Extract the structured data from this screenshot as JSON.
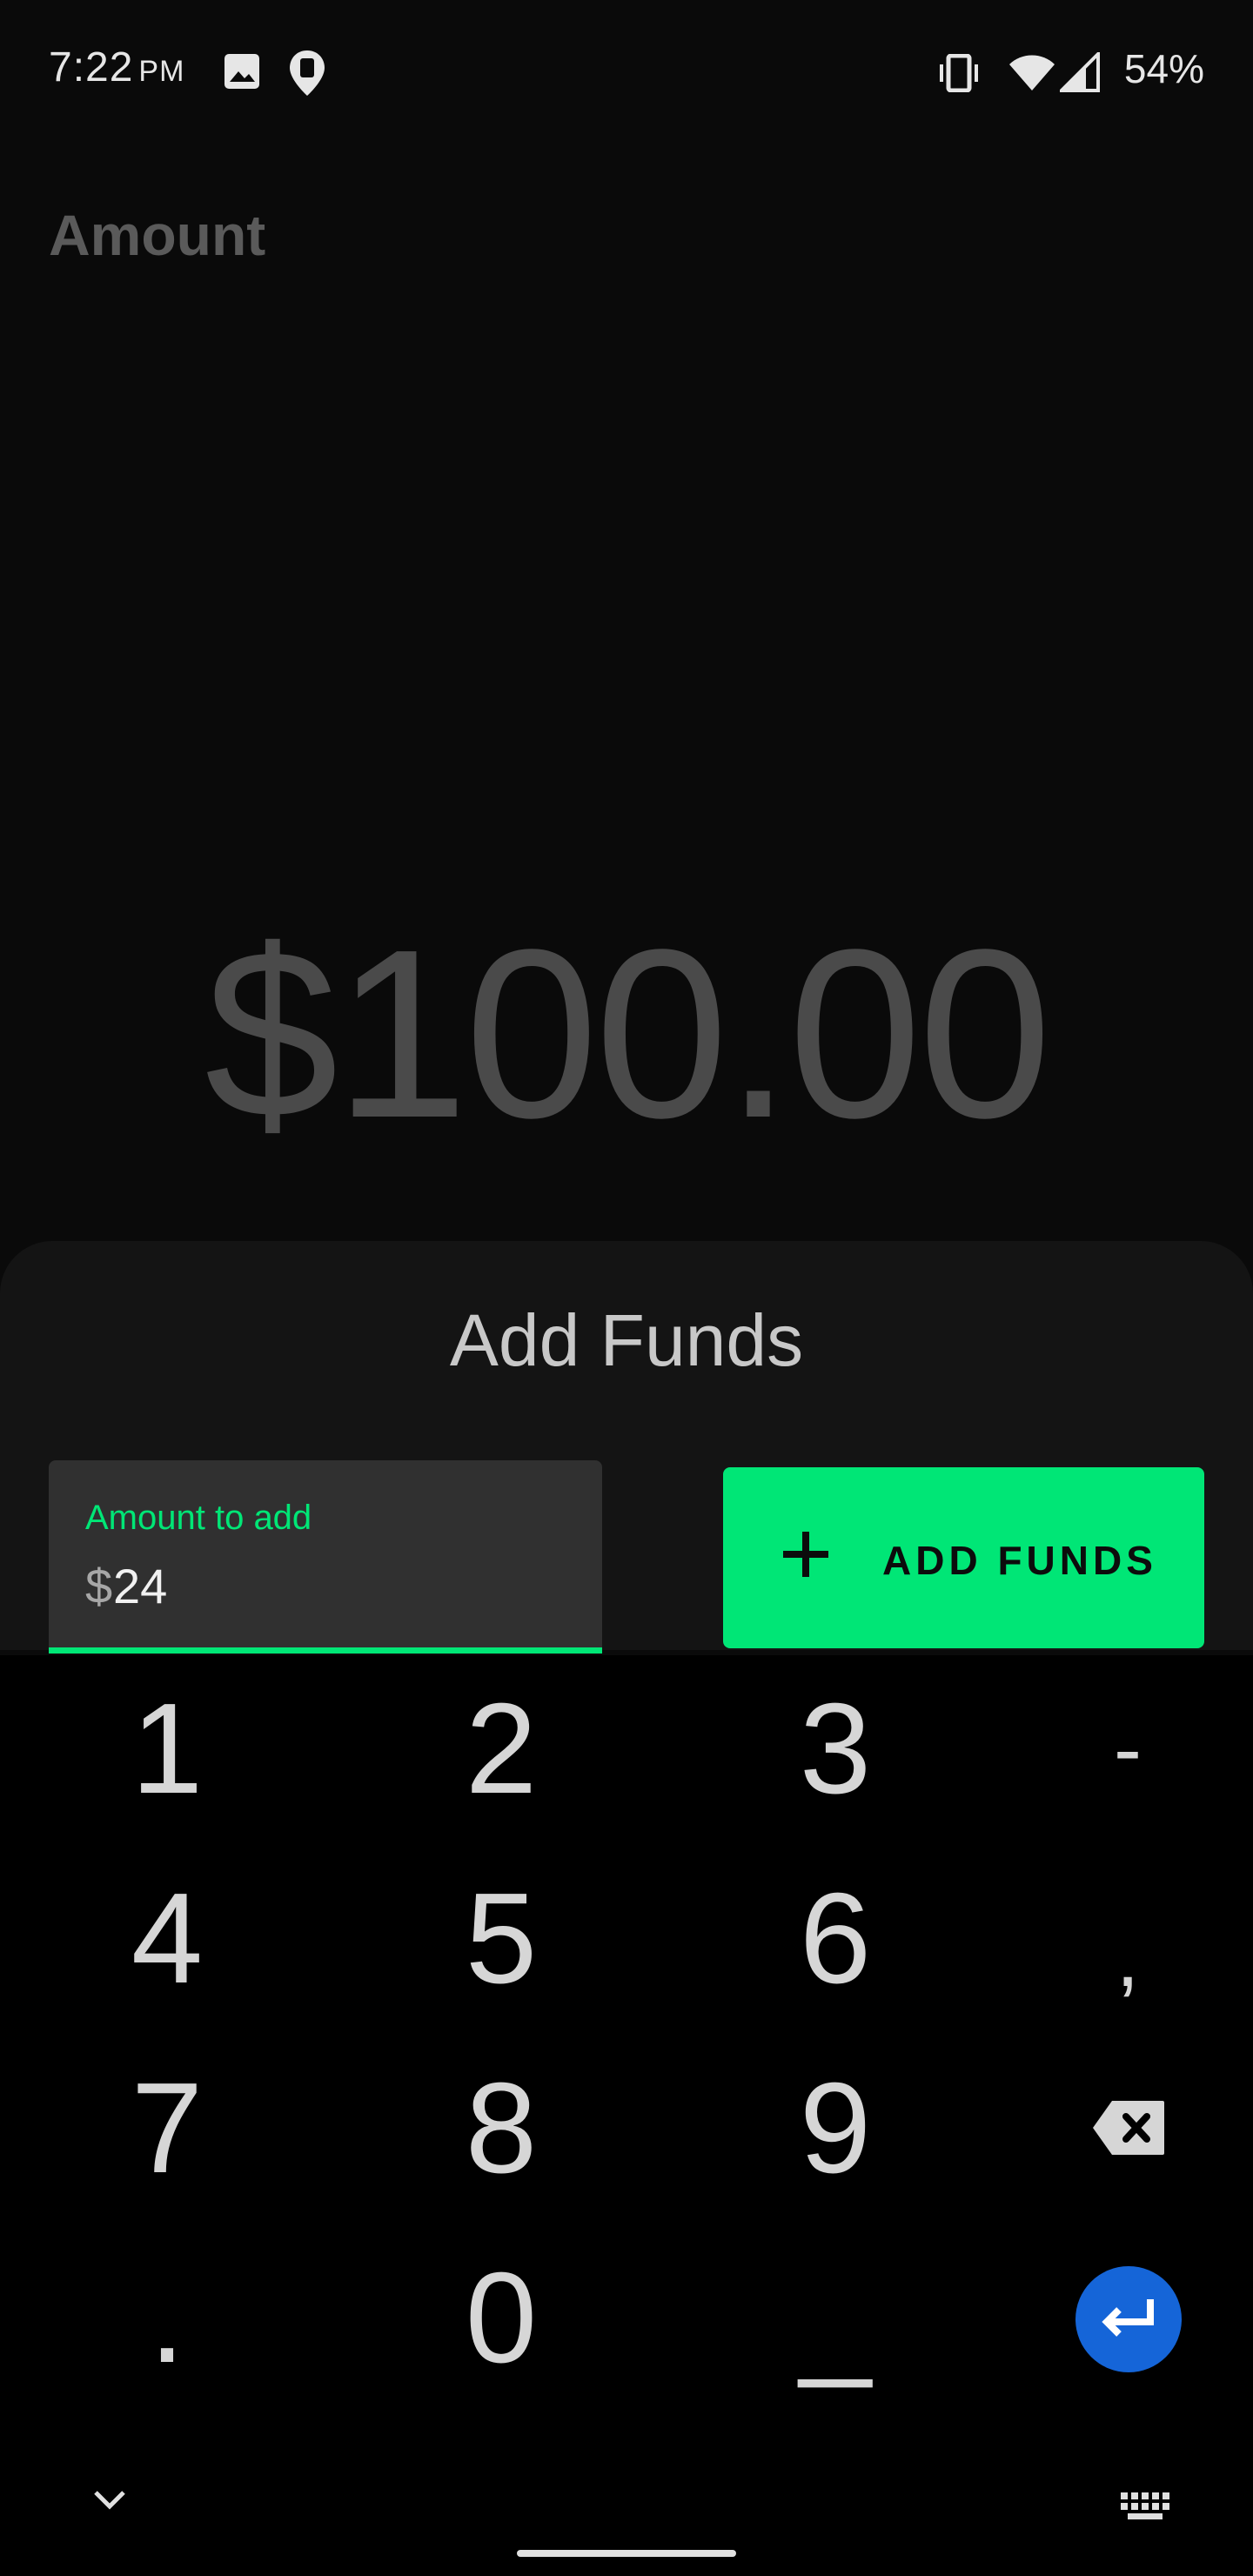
{
  "status_bar": {
    "time": "7:22",
    "ampm": "PM",
    "battery": "54%",
    "icons": [
      "image-icon",
      "location-pin-icon",
      "vibrate-icon",
      "wifi-icon",
      "cell-signal-icon"
    ]
  },
  "screen": {
    "label": "Amount",
    "amount": "$100.00"
  },
  "sheet": {
    "title": "Add Funds",
    "field": {
      "label": "Amount to add",
      "prefix": "$",
      "value": "24"
    },
    "button": {
      "label": "ADD FUNDS",
      "icon": "plus-icon"
    }
  },
  "keypad": {
    "row1": [
      "1",
      "2",
      "3",
      "-"
    ],
    "row2": [
      "4",
      "5",
      "6",
      ","
    ],
    "row3": [
      "7",
      "8",
      "9"
    ],
    "row4": [
      ".",
      "0",
      "_"
    ],
    "icons": [
      "backspace-icon",
      "enter-icon",
      "chevron-down-icon",
      "keyboard-icon"
    ]
  },
  "colors": {
    "accent": "#00e676",
    "enter": "#1565d8",
    "sheet": "#141414",
    "field": "#303030"
  }
}
